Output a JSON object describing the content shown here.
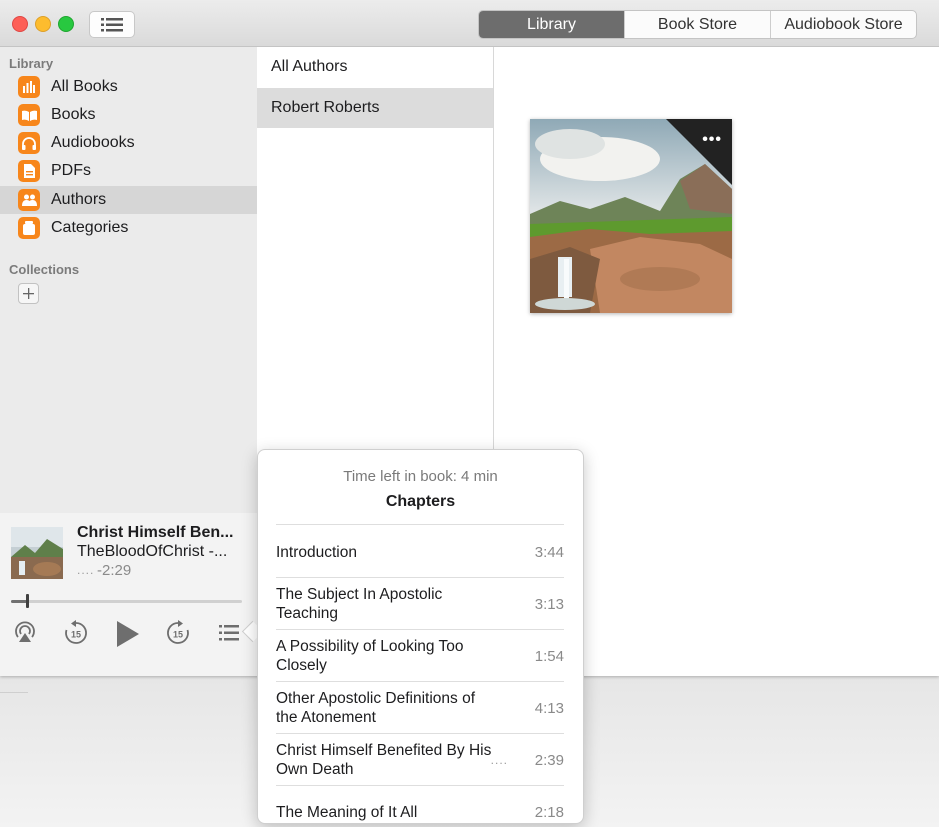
{
  "toolbar": {
    "tabs": [
      {
        "label": "Library",
        "active": true
      },
      {
        "label": "Book Store",
        "active": false
      },
      {
        "label": "Audiobook Store",
        "active": false
      }
    ]
  },
  "sidebar": {
    "library_heading": "Library",
    "items": [
      {
        "label": "All Books",
        "icon": "chart-icon",
        "selected": false
      },
      {
        "label": "Books",
        "icon": "open-book-icon",
        "selected": false
      },
      {
        "label": "Audiobooks",
        "icon": "headphones-icon",
        "selected": false
      },
      {
        "label": "PDFs",
        "icon": "pdf-document-icon",
        "selected": false
      },
      {
        "label": "Authors",
        "icon": "people-icon",
        "selected": true
      },
      {
        "label": "Categories",
        "icon": "category-icon",
        "selected": false
      }
    ],
    "collections_heading": "Collections",
    "icon_color": "#f7861b"
  },
  "player": {
    "title": "Christ Himself Ben...",
    "author": "TheBloodOfChrist -...",
    "dots": "....",
    "time_remaining": "-2:29",
    "progress": 0.07,
    "skip_back_label": "15",
    "skip_forward_label": "15"
  },
  "authors": {
    "items": [
      {
        "label": "All Authors",
        "selected": false
      },
      {
        "label": "Robert Roberts",
        "selected": true
      }
    ]
  },
  "book": {
    "more_label": "•••"
  },
  "chapters_popover": {
    "time_left": "Time left in book: 4 min",
    "heading": "Chapters",
    "items": [
      {
        "title": "Introduction",
        "duration": "3:44"
      },
      {
        "title": "The Subject In Apostolic Teaching",
        "duration": "3:13"
      },
      {
        "title": "A Possibility of Looking Too Closely",
        "duration": "1:54"
      },
      {
        "title": "Other Apostolic Definitions of the Atonement",
        "duration": "4:13"
      },
      {
        "title": "Christ Himself Benefited By His Own Death",
        "duration": "2:39",
        "playing_indicator": "...."
      },
      {
        "title": "The Meaning of It All",
        "duration": "2:18"
      }
    ]
  }
}
